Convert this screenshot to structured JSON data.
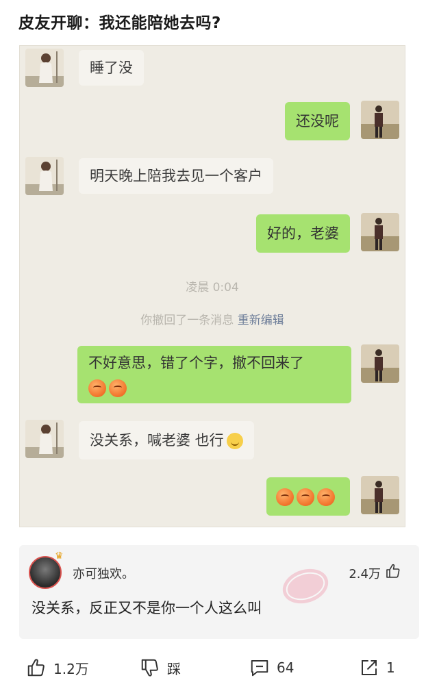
{
  "post": {
    "title": "皮友开聊：我还能陪她去吗?"
  },
  "chat": {
    "messages": [
      {
        "side": "in",
        "text": "睡了没"
      },
      {
        "side": "out",
        "text": "还没呢"
      },
      {
        "side": "in",
        "text": "明天晚上陪我去见一个客户"
      },
      {
        "side": "out",
        "text": "好的，老婆"
      },
      {
        "side": "out",
        "text": "不好意思，错了个字，撤不回来了"
      },
      {
        "side": "in",
        "text": "没关系，喊老婆 也行"
      }
    ],
    "system_time": "凌晨 0:04",
    "recall_notice": "你撤回了一条消息",
    "recall_edit": "重新编辑"
  },
  "comment": {
    "username": "亦可独欢。",
    "likes": "2.4万",
    "text": "没关系，反正又不是你一个人这么叫"
  },
  "actions": {
    "like_count": "1.2万",
    "dislike_label": "踩",
    "comment_count": "64",
    "share_count": "1"
  },
  "colors": {
    "out_bubble": "#a6e270",
    "in_bubble": "#f5f3ee",
    "chat_bg": "#efece4"
  }
}
